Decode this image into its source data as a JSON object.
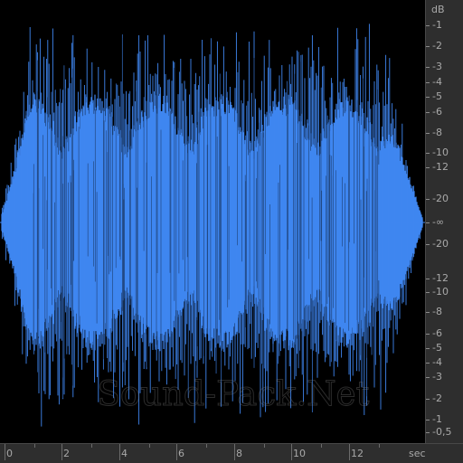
{
  "waveform": {
    "color": "#3f86f0",
    "background": "#000000",
    "duration_sec": 14.4,
    "peak_db": -1
  },
  "db_ruler": {
    "unit_label": "dB",
    "top_half": [
      "-1",
      "-2",
      "-3",
      "-4",
      "-5",
      "-6",
      "-8",
      "-10",
      "-12",
      "-20"
    ],
    "center": "-∞",
    "bottom_half": [
      "-20",
      "-12",
      "-10",
      "-8",
      "-6",
      "-5",
      "-4",
      "-3",
      "-2",
      "-1",
      "-0,5"
    ]
  },
  "time_ruler": {
    "labels": [
      "0",
      "2",
      "4",
      "6",
      "8",
      "10",
      "12"
    ],
    "unit_label": "sec"
  },
  "watermark": {
    "text": "Sound-Pack.Net"
  }
}
